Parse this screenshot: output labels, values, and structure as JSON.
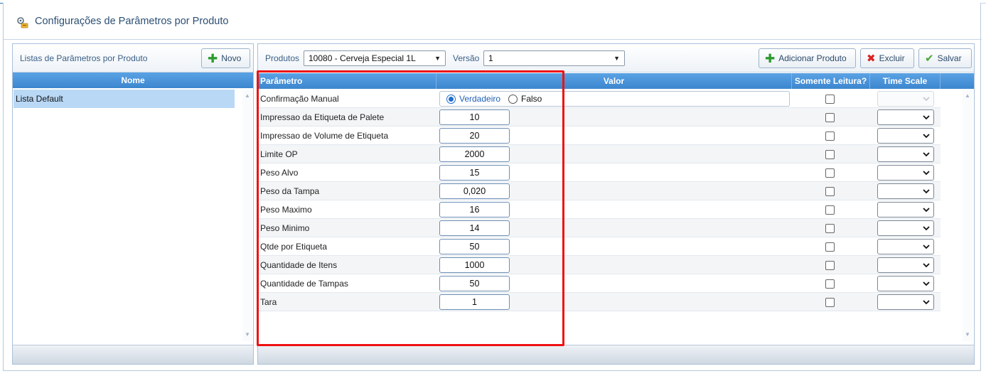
{
  "window": {
    "title": "Configurações de Parâmetros por Produto",
    "icon": "settings-wrench-icon"
  },
  "left_panel": {
    "title": "Listas de Parâmetros por Produto",
    "new_button": "Novo",
    "column": "Nome",
    "items": [
      "Lista Default"
    ]
  },
  "right_panel": {
    "produto_label": "Produtos",
    "produto_value": "10080 - Cerveja Especial 1L",
    "versao_label": "Versão",
    "versao_value": "1",
    "add_button": "Adicionar Produto",
    "delete_button": "Excluir",
    "save_button": "Salvar",
    "columns": {
      "parametro": "Parâmetro",
      "valor": "Valor",
      "readonly": "Somente Leitura?",
      "timescale": "Time Scale"
    },
    "radio": {
      "true_label": "Verdadeiro",
      "false_label": "Falso",
      "selected": "Verdadeiro"
    },
    "rows": [
      {
        "name": "Confirmação Manual",
        "value": ""
      },
      {
        "name": "Impressao da Etiqueta de Palete",
        "value": "10"
      },
      {
        "name": "Impressao de Volume de Etiqueta",
        "value": "20"
      },
      {
        "name": "Limite OP",
        "value": "2000"
      },
      {
        "name": "Peso Alvo",
        "value": "15"
      },
      {
        "name": "Peso da Tampa",
        "value": "0,020"
      },
      {
        "name": "Peso Maximo",
        "value": "16"
      },
      {
        "name": "Peso Minimo",
        "value": "14"
      },
      {
        "name": "Qtde por Etiqueta",
        "value": "50"
      },
      {
        "name": "Quantidade de Itens",
        "value": "1000"
      },
      {
        "name": "Quantidade de Tampas",
        "value": "50"
      },
      {
        "name": "Tara",
        "value": "1"
      }
    ]
  },
  "colors": {
    "header_blue": "#4a94dc",
    "highlight_red": "#ee1111",
    "selected_row": "#b9d8f5"
  }
}
